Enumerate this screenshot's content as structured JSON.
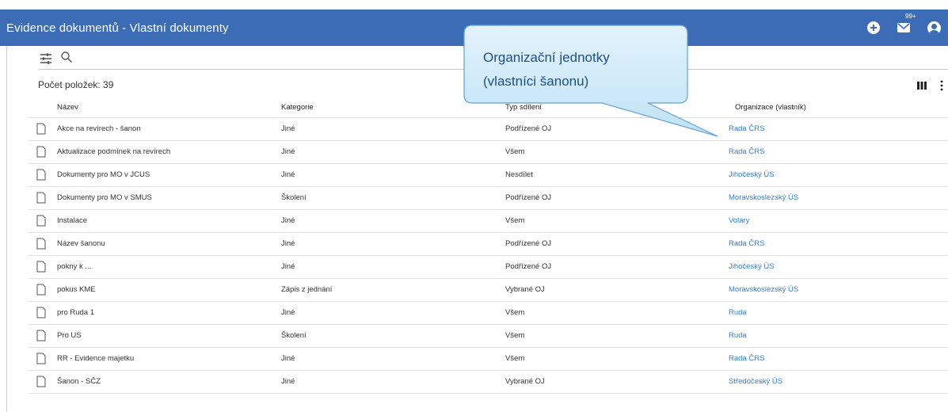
{
  "app": {
    "title": "Evidence dokumentů - Vlastní dokumenty",
    "mail_badge": "99+",
    "colors": {
      "appbar": "#3b6cb5",
      "link": "#2f7fd1",
      "callout_fill": "#cfe8f7",
      "callout_border": "#6aaad8"
    }
  },
  "icons": {
    "add": "plus-circle-icon",
    "mail": "mail-icon",
    "account": "account-icon",
    "filter": "filter-icon",
    "search": "search-icon",
    "columns": "columns-icon",
    "more": "more-vertical-icon",
    "document": "document-icon"
  },
  "toolbar": {
    "search_placeholder": "",
    "count_label": "Počet položek: 39"
  },
  "table": {
    "headers": {
      "name": "Název",
      "category": "Kategorie",
      "share": "Typ sdílení",
      "org": "Organizace (vlastník)"
    },
    "rows": [
      {
        "name": "Akce na revírech - šanon",
        "category": "Jiné",
        "share": "Podřízené OJ",
        "org": "Rada ČRS"
      },
      {
        "name": "Aktualizace podmínek na revírech",
        "category": "Jiné",
        "share": "Všem",
        "org": "Rada ČRS"
      },
      {
        "name": "Dokumenty pro MO v JCUS",
        "category": "Jiné",
        "share": "Nesdílet",
        "org": "Jihočeský ÚS"
      },
      {
        "name": "Dokumenty pro MO v SMUS",
        "category": "Školení",
        "share": "Podřízené OJ",
        "org": "Moravskoslezský ÚS"
      },
      {
        "name": "Instalace",
        "category": "Jiné",
        "share": "Všem",
        "org": "Volary"
      },
      {
        "name": "Název šanonu",
        "category": "Jiné",
        "share": "Podřízené OJ",
        "org": "Rada ČRS"
      },
      {
        "name": "pokny k ...",
        "category": "Jiné",
        "share": "Podřízené OJ",
        "org": "Jihočeský ÚS"
      },
      {
        "name": "pokus KME",
        "category": "Zápis z jednání",
        "share": "Vybrané OJ",
        "org": "Moravskoslezský ÚS"
      },
      {
        "name": "pro Ruda 1",
        "category": "Jiné",
        "share": "Všem",
        "org": "Ruda"
      },
      {
        "name": "Pro US",
        "category": "Školení",
        "share": "Všem",
        "org": "Ruda"
      },
      {
        "name": "RR - Evidence majetku",
        "category": "Jiné",
        "share": "Všem",
        "org": "Rada ČRS"
      },
      {
        "name": "Šanon - SČZ",
        "category": "Jiné",
        "share": "Vybrané OJ",
        "org": "Středočeský ÚS"
      }
    ]
  },
  "callout": {
    "line1": "Organizační jednotky",
    "line2": "(vlastníci šanonu)"
  }
}
